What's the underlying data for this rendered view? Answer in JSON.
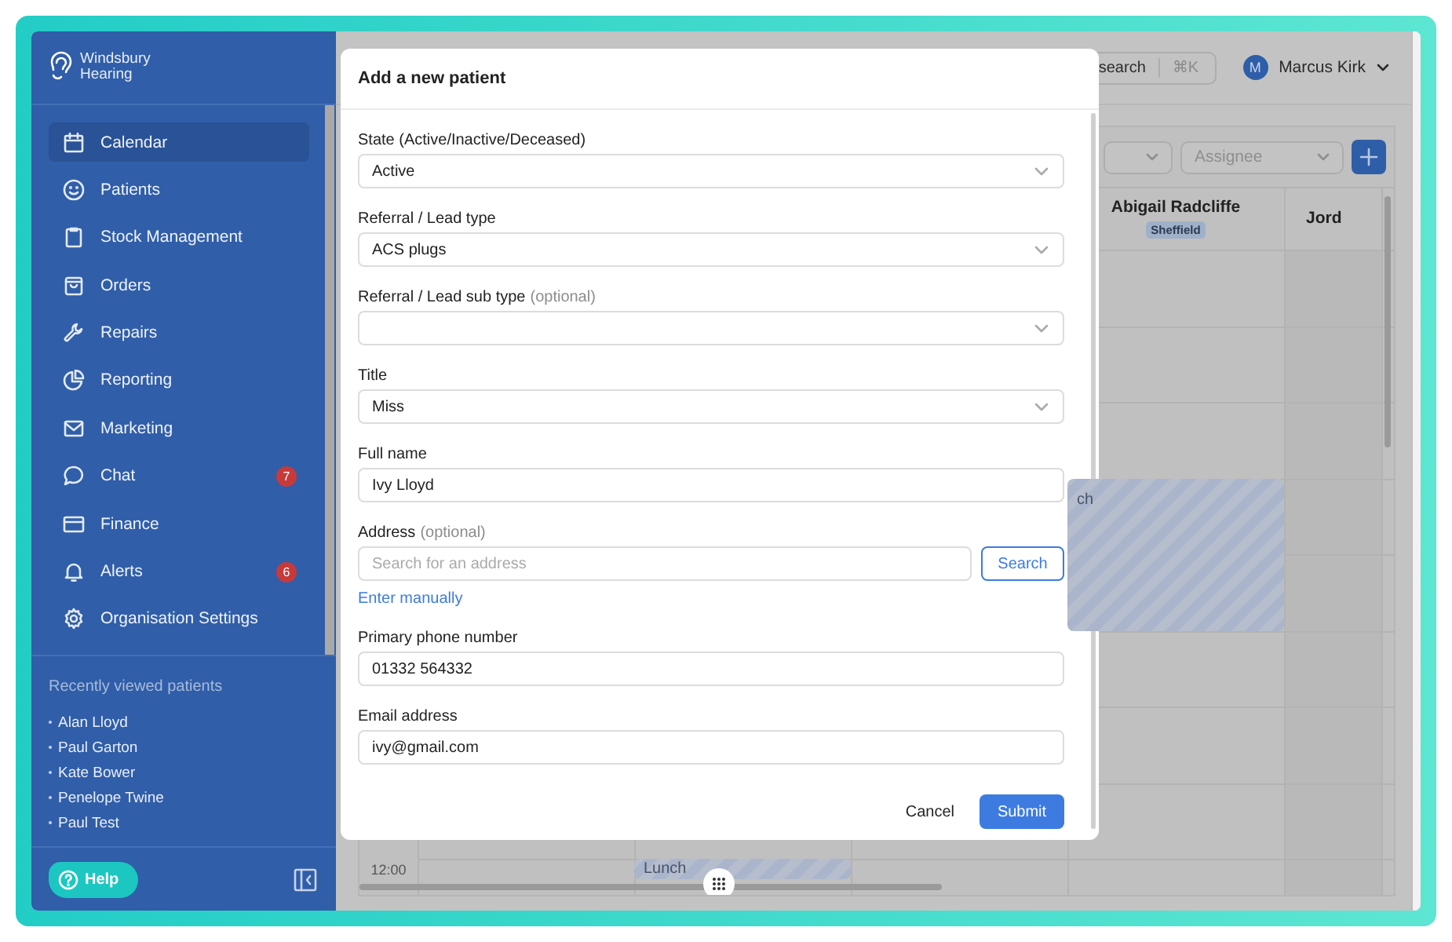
{
  "sidebar": {
    "logo": {
      "line_1": "Windsbury",
      "line_2": "Hearing"
    },
    "nav_items": [
      {
        "label": "Calendar",
        "selected": true
      },
      {
        "label": "Patients",
        "selected": false
      },
      {
        "label": "Stock Management",
        "selected": false
      },
      {
        "label": "Orders",
        "selected": false
      },
      {
        "label": "Repairs",
        "selected": false
      },
      {
        "label": "Reporting",
        "selected": false
      },
      {
        "label": "Marketing",
        "selected": false
      },
      {
        "label": "Chat",
        "selected": false,
        "badge": "7"
      },
      {
        "label": "Finance",
        "selected": false
      },
      {
        "label": "Alerts",
        "selected": false,
        "badge": "6"
      },
      {
        "label": "Organisation Settings",
        "selected": false
      }
    ],
    "recent": {
      "title": "Recently viewed patients",
      "patients": [
        "Alan Lloyd",
        "Paul Garton",
        "Kate Bower",
        "Penelope Twine",
        "Paul Test"
      ]
    },
    "help_button": "Help"
  },
  "top_bar": {
    "search": {
      "label": "search",
      "shortcut": "⌘K"
    },
    "user": {
      "initial": "M",
      "name": "Marcus Kirk"
    }
  },
  "filters": [
    {
      "placeholder": "Assignee"
    }
  ],
  "calendar": {
    "columns": [
      {
        "name": "Abigail Radcliffe",
        "location": "Sheffield"
      },
      {
        "name": "Jord"
      }
    ],
    "times": [
      "12:00"
    ],
    "events": [
      {
        "text": "ch"
      },
      {
        "text": "Lunch"
      }
    ]
  },
  "modal": {
    "title": "Add a new patient",
    "fields": [
      {
        "kind": "select",
        "label": "State (Active/Inactive/Deceased)",
        "value": "Active"
      },
      {
        "kind": "select",
        "label": "Referral / Lead type",
        "value": "ACS plugs"
      },
      {
        "kind": "select",
        "label": "Referral / Lead sub type",
        "hint": "(optional)"
      },
      {
        "kind": "select",
        "label": "Title",
        "value": "Miss"
      },
      {
        "kind": "input",
        "label": "Full name",
        "value": "Ivy Lloyd"
      },
      {
        "kind": "address",
        "label": "Address",
        "hint": "(optional)",
        "placeholder": "Search for an address",
        "button": "Search",
        "link": "Enter manually"
      },
      {
        "kind": "input",
        "label": "Primary phone number",
        "value": "01332 564332"
      },
      {
        "kind": "input",
        "label": "Email address",
        "value": "ivy@gmail.com"
      }
    ],
    "cancel": "Cancel",
    "submit": "Submit"
  }
}
